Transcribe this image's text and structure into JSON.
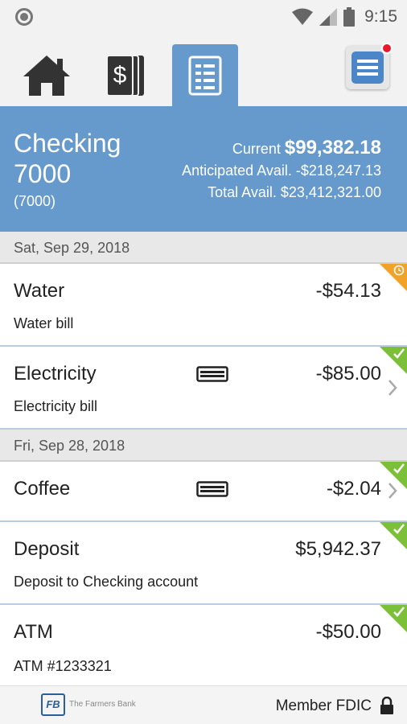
{
  "status_bar": {
    "time": "9:15"
  },
  "tabs": [
    {
      "name": "home",
      "icon": "home-icon",
      "active": false
    },
    {
      "name": "accounts",
      "icon": "dollar-cards-icon",
      "active": false
    },
    {
      "name": "register",
      "icon": "document-list-icon",
      "active": true
    }
  ],
  "menu": {
    "icon": "menu-icon",
    "has_notification": true
  },
  "account": {
    "name": "Checking 7000",
    "number": "(7000)",
    "current_label": "Current",
    "current_value": "$99,382.18",
    "anticipated_label": "Anticipated Avail.",
    "anticipated_value": "-$218,247.13",
    "total_label": "Total Avail.",
    "total_value": "$23,412,321.00"
  },
  "groups": [
    {
      "date": "Sat, Sep 29, 2018",
      "transactions": [
        {
          "title": "Water",
          "description": "Water bill",
          "amount": "-$54.13",
          "status": "pending"
        },
        {
          "title": "Electricity",
          "description": "Electricity bill",
          "amount": "-$85.00",
          "status": "cleared",
          "card": true
        }
      ]
    },
    {
      "date": "Fri, Sep 28, 2018",
      "transactions": [
        {
          "title": "Coffee",
          "description": "",
          "amount": "-$2.04",
          "status": "cleared",
          "card": true
        },
        {
          "title": "Deposit",
          "description": "Deposit to Checking account",
          "amount": "$5,942.37",
          "status": "cleared"
        },
        {
          "title": "ATM",
          "description": "ATM #1233321",
          "amount": "-$50.00",
          "status": "cleared"
        }
      ]
    }
  ],
  "footer": {
    "logo_text": "FB",
    "bank_name": "The Farmers Bank",
    "fdic_label": "Member FDIC"
  },
  "colors": {
    "accent": "#6699cc",
    "cleared": "#7cc03a",
    "pending": "#f0a328",
    "badge": "#e8192c"
  }
}
